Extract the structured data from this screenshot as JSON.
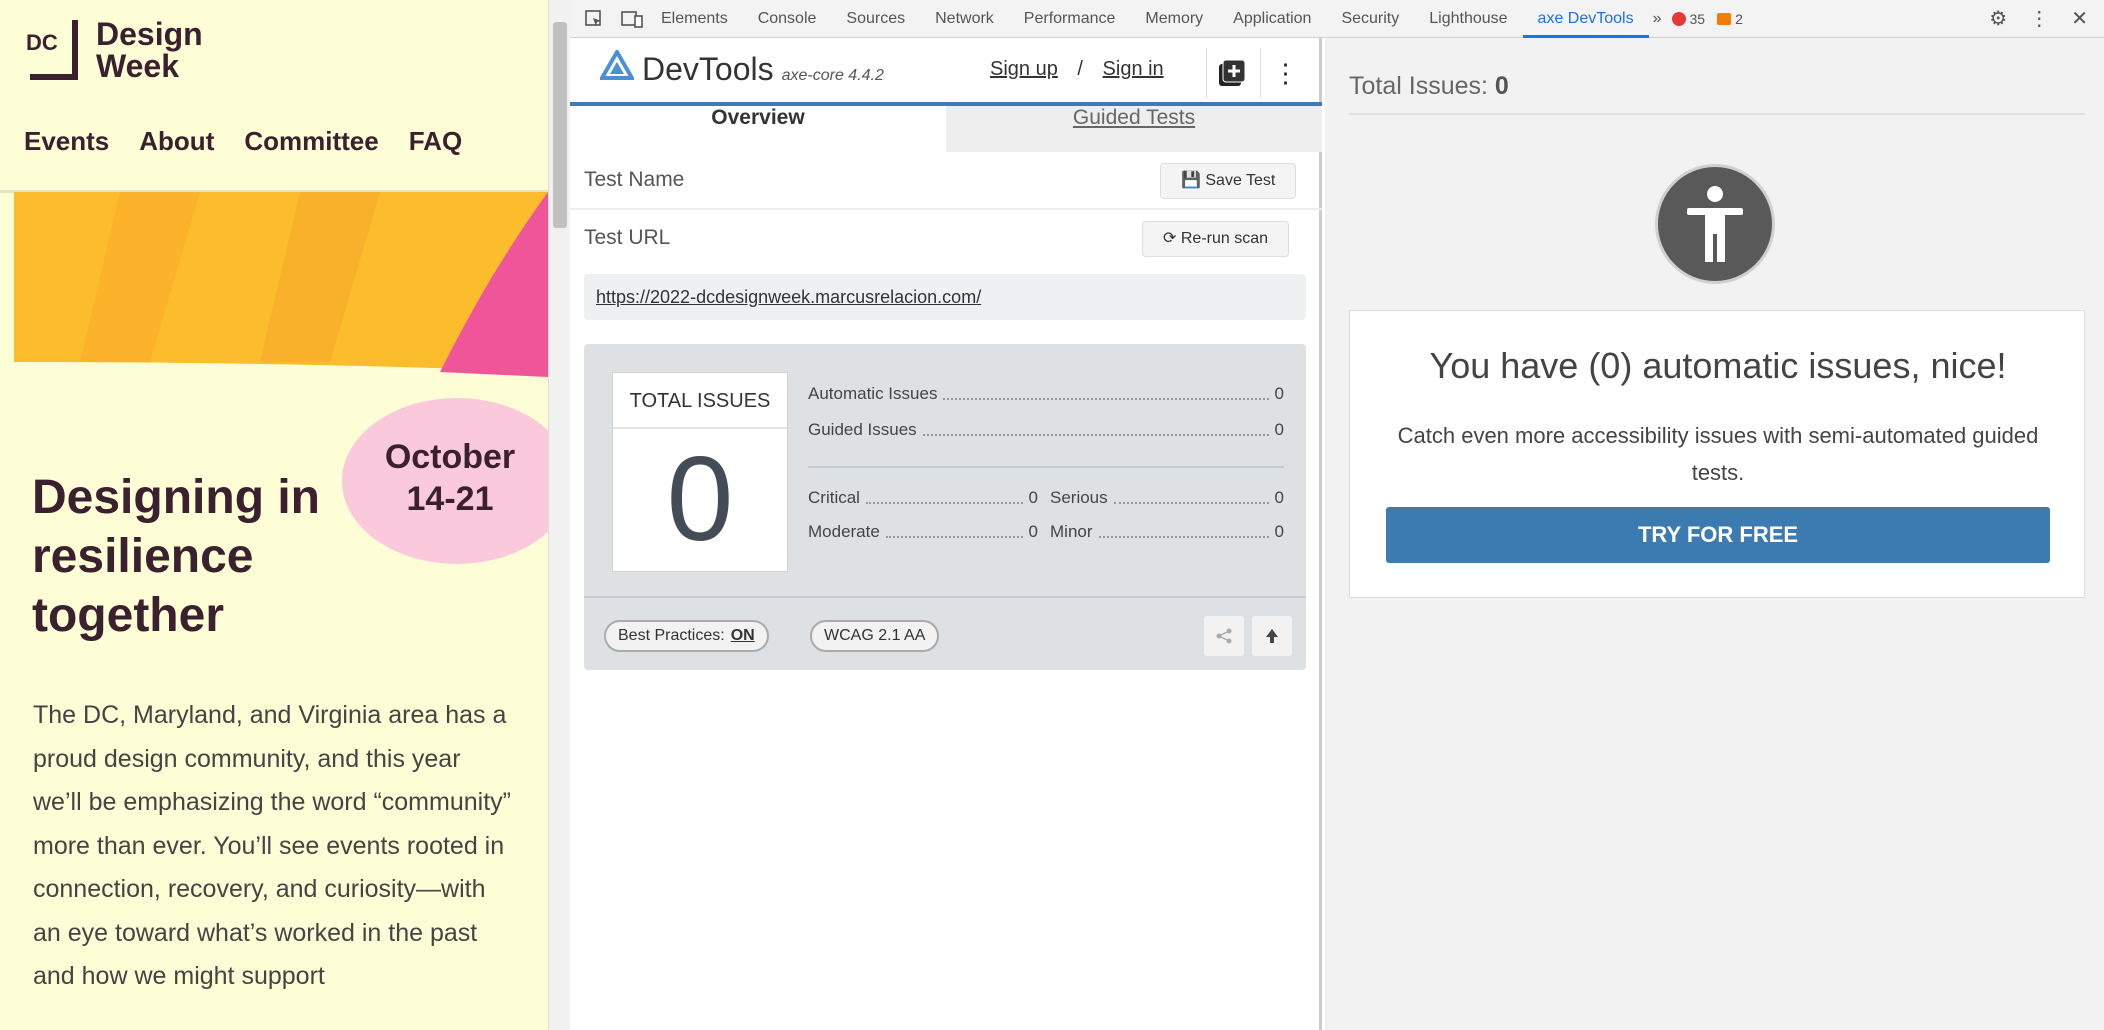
{
  "site": {
    "logo_mark": "DC",
    "logo_line1": "Design",
    "logo_line2": "Week",
    "nav": [
      "Events",
      "About",
      "Committee",
      "FAQ"
    ],
    "date_line1": "October",
    "date_line2": "14-21",
    "headline": "Designing in resilience together",
    "intro": "The DC, Maryland, and Virginia area has a proud design community, and this year we’ll be emphasizing the word “community” more than ever. You’ll see events rooted in connection, recovery, and curiosity—with an eye toward what’s worked in the past and how we might support",
    "colors": {
      "background": "#fdfdd6",
      "ink": "#3b2130",
      "banner_yellow": "#fbbd2c",
      "banner_pink": "#f0559a",
      "date_blob": "#fbc9dc"
    }
  },
  "devtools_tabs": {
    "tabs": [
      "Elements",
      "Console",
      "Sources",
      "Network",
      "Performance",
      "Memory",
      "Application",
      "Security",
      "Lighthouse",
      "axe DevTools"
    ],
    "active_tab": "axe DevTools",
    "more_label": "»",
    "error_count": "35",
    "warning_count": "2",
    "icons": [
      "inspect-icon",
      "device-toggle-icon",
      "settings-icon",
      "kebab-menu-icon",
      "close-icon"
    ]
  },
  "axe": {
    "brand": "DevTools",
    "version": "axe-core 4.4.2",
    "sign_up": "Sign up",
    "auth_separator": "/",
    "sign_in": "Sign in",
    "tabs": {
      "overview": "Overview",
      "guided": "Guided Tests"
    },
    "test_name_label": "Test Name",
    "save_test": "Save Test",
    "test_url_label": "Test URL",
    "rerun_scan": "Re-run scan",
    "test_url": "https://2022-dcdesignweek.marcusrelacion.com/",
    "total_issues_caption": "TOTAL ISSUES",
    "total_issues_value": "0",
    "stats": {
      "automatic_label": "Automatic Issues",
      "automatic_value": "0",
      "guided_label": "Guided Issues",
      "guided_value": "0",
      "critical_label": "Critical",
      "critical_value": "0",
      "serious_label": "Serious",
      "serious_value": "0",
      "moderate_label": "Moderate",
      "moderate_value": "0",
      "minor_label": "Minor",
      "minor_value": "0"
    },
    "best_practices_label": "Best Practices:",
    "best_practices_value": "ON",
    "wcag_label": "WCAG 2.1 AA",
    "accent_color": "#3c7bb5"
  },
  "results": {
    "total_label": "Total Issues:",
    "total_value": "0",
    "headline": "You have (0) automatic issues, nice!",
    "body": "Catch even more accessibility issues with semi-automated guided tests.",
    "cta": "TRY FOR FREE",
    "cta_color": "#3c7bb0"
  }
}
